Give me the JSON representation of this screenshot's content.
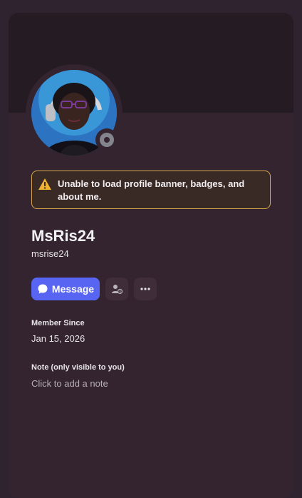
{
  "warning": {
    "text": "Unable to load profile banner, badges, and about me."
  },
  "profile": {
    "display_name": "MsRis24",
    "username": "msrise24",
    "status": "offline"
  },
  "actions": {
    "message_label": "Message",
    "add_friend_icon": "add-friend-icon",
    "more_icon": "more-icon"
  },
  "member_since": {
    "label": "Member Since",
    "value": "Jan 15, 2026"
  },
  "note": {
    "label": "Note (only visible to you)",
    "placeholder": "Click to add a note"
  },
  "colors": {
    "accent": "#5865f2",
    "warning_border": "#d6a84a",
    "status_offline": "#84848d"
  }
}
